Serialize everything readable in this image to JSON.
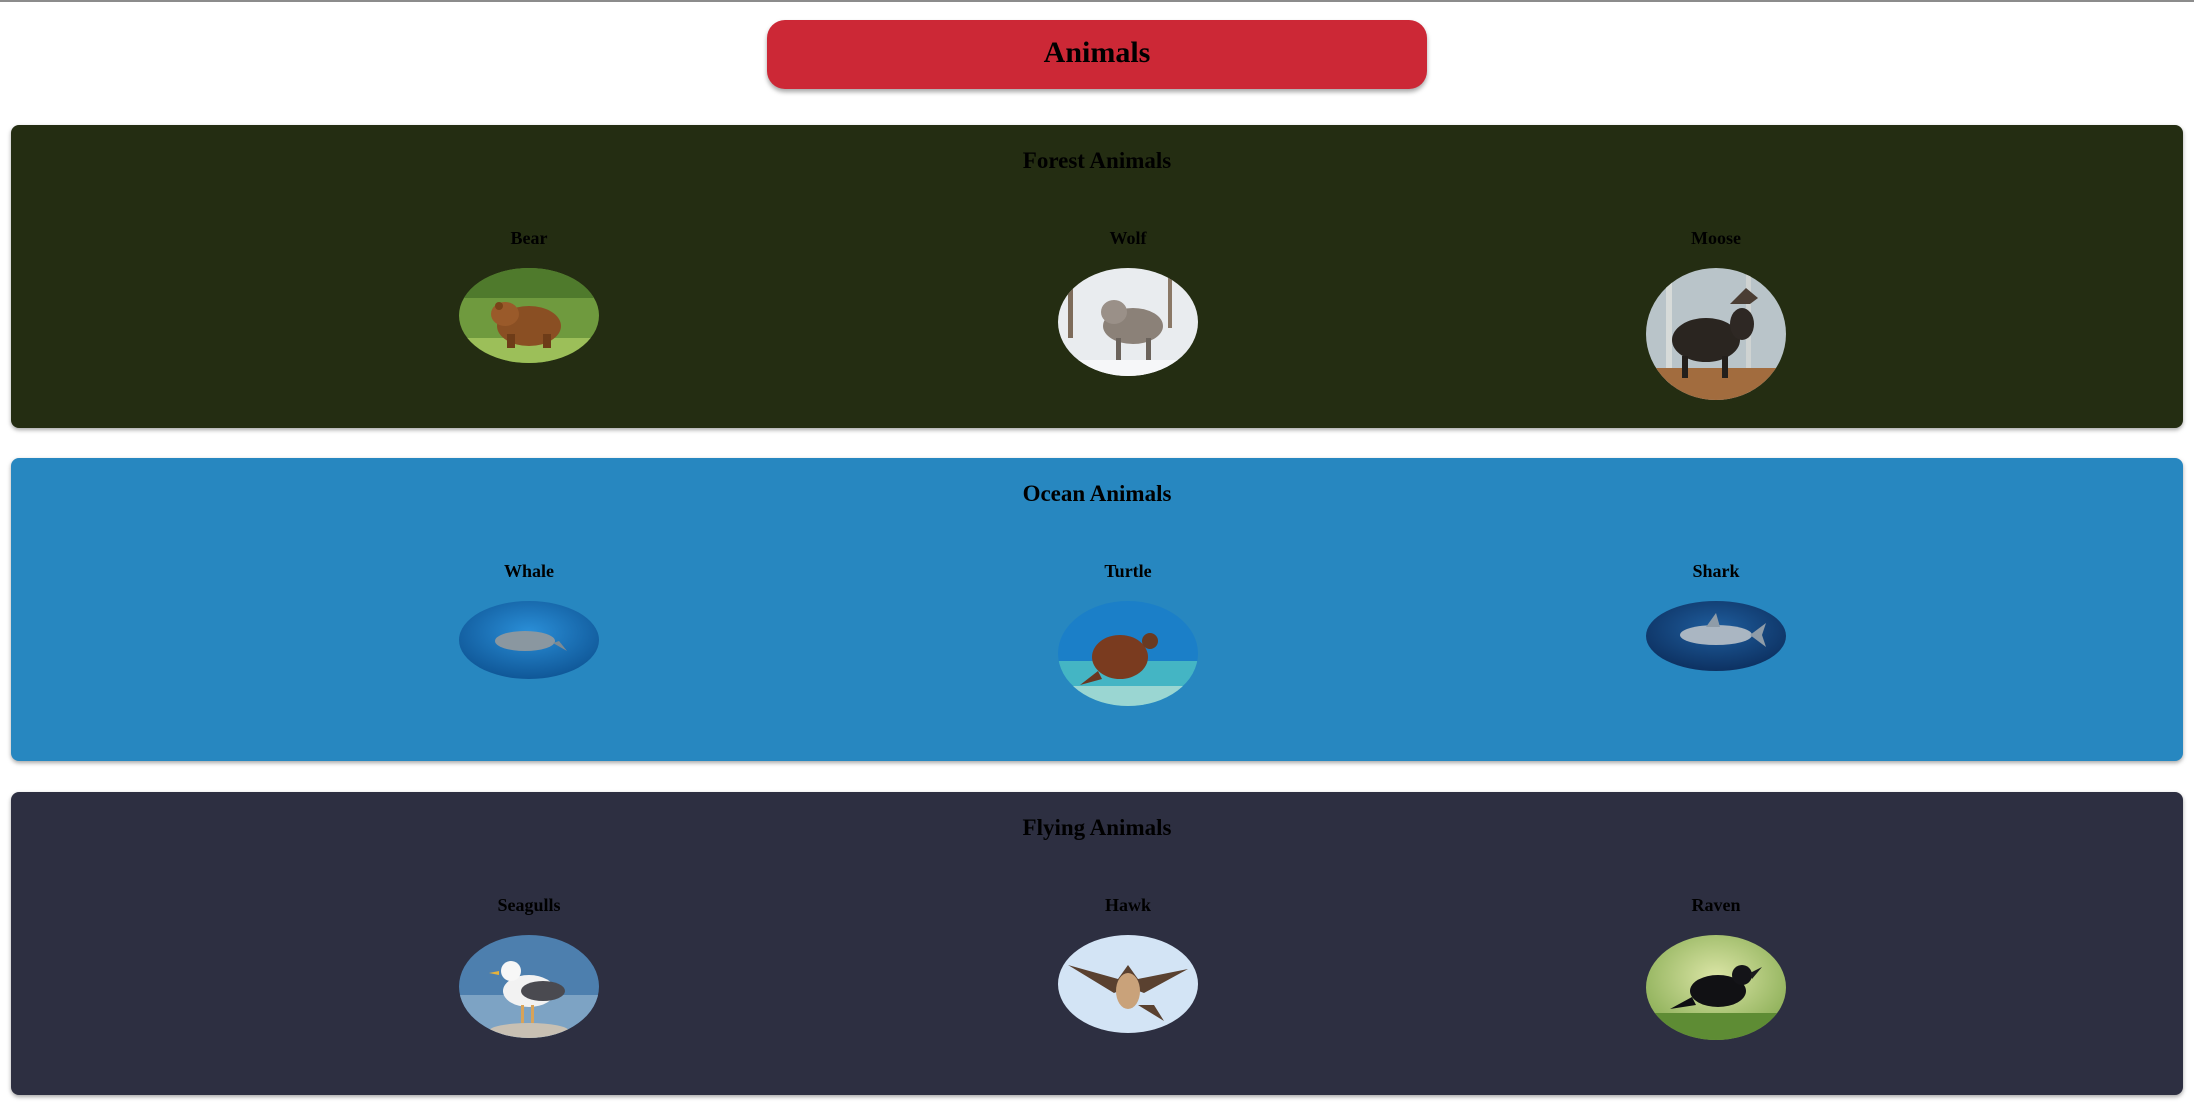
{
  "header": {
    "title": "Animals"
  },
  "sections": [
    {
      "title": "Forest Animals",
      "color": "#242d12",
      "animals": [
        {
          "name": "Bear",
          "icon": "bear-photo"
        },
        {
          "name": "Wolf",
          "icon": "wolf-photo"
        },
        {
          "name": "Moose",
          "icon": "moose-photo"
        }
      ]
    },
    {
      "title": "Ocean Animals",
      "color": "#2787c0",
      "animals": [
        {
          "name": "Whale",
          "icon": "whale-photo"
        },
        {
          "name": "Turtle",
          "icon": "turtle-photo"
        },
        {
          "name": "Shark",
          "icon": "shark-photo"
        }
      ]
    },
    {
      "title": "Flying Animals",
      "color": "#2d2f41",
      "animals": [
        {
          "name": "Seagulls",
          "icon": "seagull-photo"
        },
        {
          "name": "Hawk",
          "icon": "hawk-photo"
        },
        {
          "name": "Raven",
          "icon": "raven-photo"
        }
      ]
    }
  ]
}
